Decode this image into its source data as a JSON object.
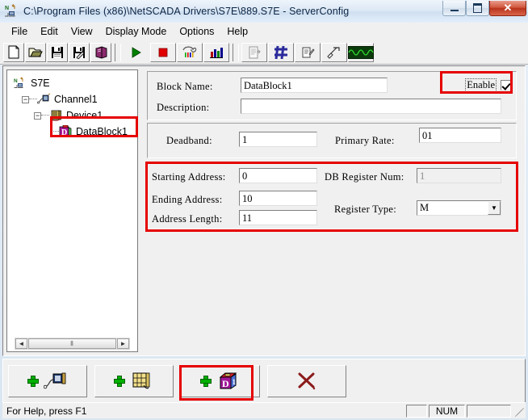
{
  "window": {
    "title": "C:\\Program Files (x86)\\NetSCADA Drivers\\S7E\\889.S7E - ServerConfig",
    "icon": "app-icon",
    "controls": {
      "minimize": "–",
      "maximize": "□",
      "close": "✕"
    }
  },
  "menubar": {
    "items": [
      {
        "label": "File"
      },
      {
        "label": "Edit"
      },
      {
        "label": "View"
      },
      {
        "label": "Display Mode"
      },
      {
        "label": "Options"
      },
      {
        "label": "Help"
      }
    ]
  },
  "toolbar": {
    "buttons": [
      {
        "name": "new-file-icon",
        "tip": "New"
      },
      {
        "name": "open-folder-icon",
        "tip": "Open"
      },
      {
        "name": "save-disk-icon",
        "tip": "Save"
      },
      {
        "name": "save-as-disk-icon",
        "tip": "Save As"
      },
      {
        "name": "book-icon",
        "tip": "Help Book"
      },
      {
        "name": "play-run-icon",
        "tip": "Start"
      },
      {
        "name": "stop-square-icon",
        "tip": "Stop"
      },
      {
        "name": "wiring-tool-icon",
        "tip": "Diagnostics"
      },
      {
        "name": "bar-chart-icon",
        "tip": "Statistics"
      },
      {
        "name": "document-list-icon",
        "tip": "Report"
      },
      {
        "name": "grid-hash-icon",
        "tip": "Tag Grid"
      },
      {
        "name": "notes-pen-icon",
        "tip": "Notes"
      },
      {
        "name": "pointer-hand-icon",
        "tip": "Select"
      },
      {
        "name": "waveform-scope-icon",
        "tip": "Scope"
      }
    ]
  },
  "tree": {
    "nodes": [
      {
        "label": "S7E",
        "icon": "root-server-icon",
        "expander": "",
        "level": 0
      },
      {
        "label": "Channel1",
        "icon": "channel-icon",
        "expander": "−",
        "level": 1
      },
      {
        "label": "Device1",
        "icon": "device-icon",
        "expander": "−",
        "level": 2
      },
      {
        "label": "DataBlock1",
        "icon": "datablock-icon",
        "expander": "",
        "level": 3,
        "selected": true
      }
    ],
    "scrollbar": {
      "left_arrow": "◄",
      "right_arrow": "►",
      "thumb_grip": "⦀"
    }
  },
  "form": {
    "block_name_label": "Block Name:",
    "block_name_value": "DataBlock1",
    "description_label": "Description:",
    "description_value": "",
    "enable_label": "Enable",
    "enable_checked": true,
    "deadband_label": "Deadband:",
    "deadband_value": "1",
    "primary_rate_label": "Primary Rate:",
    "primary_rate_value": "01",
    "starting_address_label": "Starting Address:",
    "starting_address_value": "0",
    "ending_address_label": "Ending Address:",
    "ending_address_value": "10",
    "address_length_label": "Address Length:",
    "address_length_value": "11",
    "db_register_num_label": "DB Register Num:",
    "db_register_num_value": "1",
    "register_type_label": "Register Type:",
    "register_type_value": "M",
    "combo_arrow": "▼"
  },
  "bottom_buttons": [
    {
      "name": "add-channel-button",
      "icon": "add-channel-icon"
    },
    {
      "name": "add-device-button",
      "icon": "add-device-icon"
    },
    {
      "name": "add-datablock-button",
      "icon": "add-datablock-icon",
      "highlighted": true
    },
    {
      "name": "delete-button",
      "icon": "delete-x-icon"
    }
  ],
  "statusbar": {
    "help_text": "For Help, press F1",
    "pane1": "",
    "pane2": "NUM",
    "pane3": ""
  },
  "colors": {
    "highlight_red": "#e60000",
    "titlebar_blue": "#dce8f5",
    "close_red": "#c23b22",
    "face_gray": "#f0f0f0",
    "plus_green": "#00b000"
  }
}
